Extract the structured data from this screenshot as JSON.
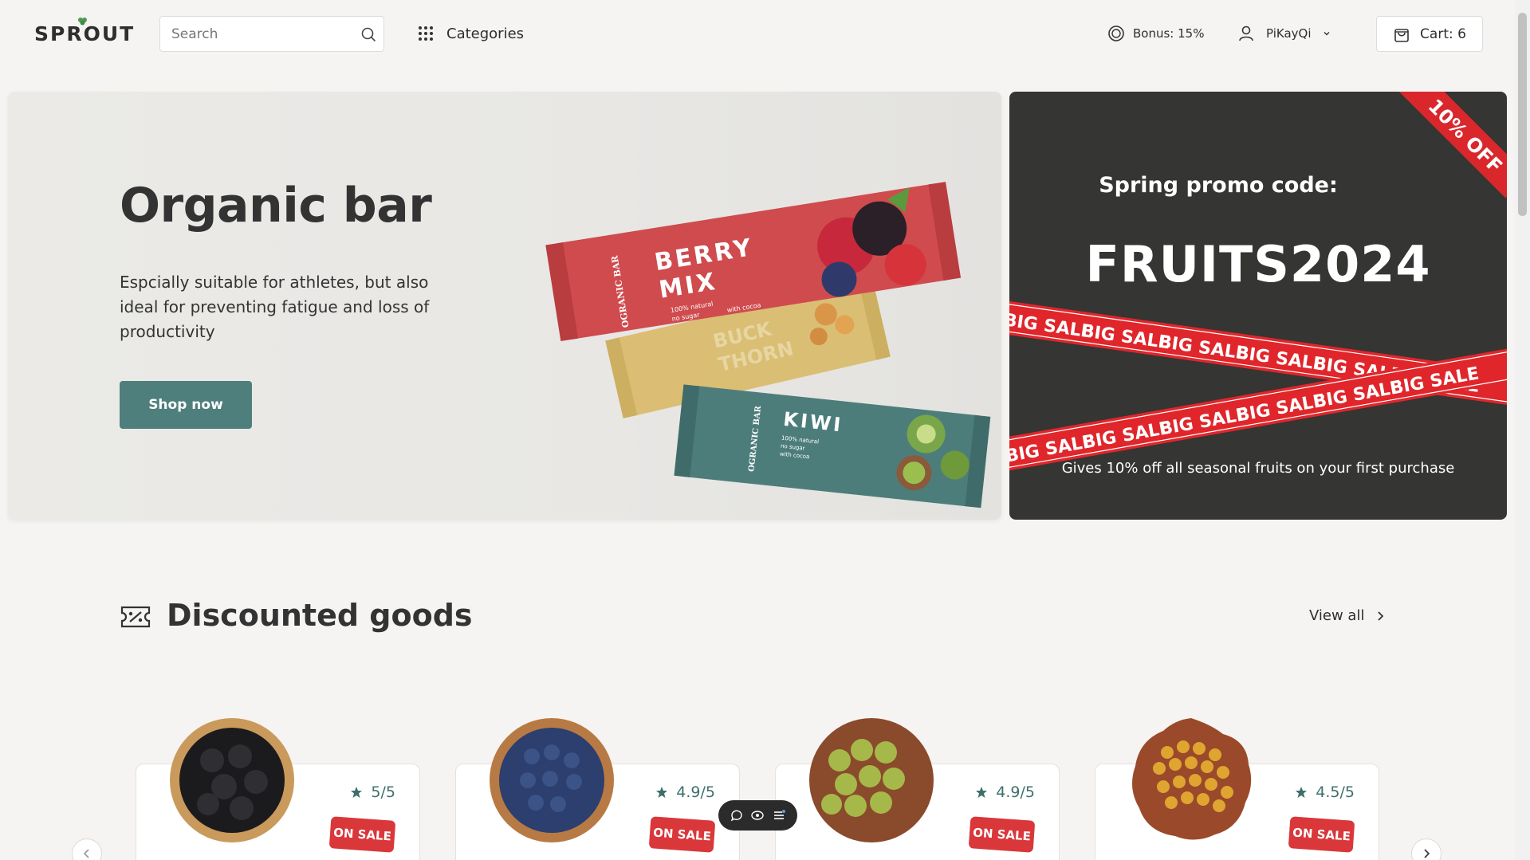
{
  "header": {
    "logo": "SPROUT",
    "search_placeholder": "Search",
    "categories_label": "Categories",
    "bonus_label": "Bonus: 15%",
    "user_name": "PiKayQi",
    "cart_label": "Cart: 6"
  },
  "hero": {
    "title": "Organic bar",
    "description": "Espcially suitable for athletes, but also ideal for preventing fatigue and loss of productivity",
    "button_label": "Shop now",
    "bars": [
      {
        "flavor_line1": "BERRY",
        "flavor_line2": "MIX",
        "brand": "OGRANIC BAR",
        "features": [
          "100% natural",
          "no sugar",
          "with cocoa"
        ]
      },
      {
        "flavor_line1": "BUCK",
        "flavor_line2": "THORN",
        "brand": "",
        "features": []
      },
      {
        "flavor_line1": "KIWI",
        "flavor_line2": "",
        "brand": "OGRANIC BAR",
        "features": [
          "100% natural",
          "no sugar",
          "with cocoa"
        ]
      }
    ]
  },
  "promo": {
    "label": "Spring promo code:",
    "code": "FRUITS2024",
    "note": "Gives 10% off all seasonal fruits on your first purchase",
    "corner_text": "10% OFF",
    "ribbon_text": "BIG SALE"
  },
  "discounted": {
    "title": "Discounted goods",
    "view_all": "View all",
    "products": [
      {
        "fruit": "blackberries",
        "rating": "5/5",
        "badge": "ON SALE"
      },
      {
        "fruit": "blueberries",
        "rating": "4.9/5",
        "badge": "ON SALE"
      },
      {
        "fruit": "green-grapes",
        "rating": "4.9/5",
        "badge": "ON SALE"
      },
      {
        "fruit": "sea-buckthorn",
        "rating": "4.5/5",
        "badge": "ON SALE"
      }
    ]
  },
  "icons": {
    "search": "search-icon",
    "categories": "grid-icon",
    "bonus": "coin-icon",
    "user": "user-icon",
    "cart": "bag-icon",
    "discount": "ticket-icon",
    "rating": "star-icon"
  },
  "colors": {
    "accent": "#4f7f7c",
    "sale": "#d9373a",
    "promo_bg": "#353533",
    "page_bg": "#f5f4f2"
  }
}
